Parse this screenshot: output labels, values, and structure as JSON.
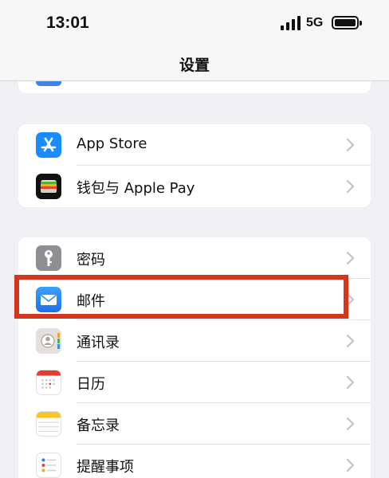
{
  "status_bar": {
    "time": "13:01",
    "network": "5G"
  },
  "nav": {
    "title": "设置"
  },
  "groups": [
    {
      "items": [
        {
          "label": "App Store",
          "icon": "app-store-icon"
        },
        {
          "label": "钱包与 Apple Pay",
          "icon": "wallet-icon"
        }
      ]
    },
    {
      "items": [
        {
          "label": "密码",
          "icon": "key-icon"
        },
        {
          "label": "邮件",
          "icon": "mail-icon",
          "highlighted": true
        },
        {
          "label": "通讯录",
          "icon": "contacts-icon"
        },
        {
          "label": "日历",
          "icon": "calendar-icon"
        },
        {
          "label": "备忘录",
          "icon": "notes-icon"
        },
        {
          "label": "提醒事项",
          "icon": "reminders-icon"
        }
      ]
    }
  ],
  "colors": {
    "highlight": "#d7341c",
    "app_store": "#1a8cff",
    "mail": "#2b8af6",
    "background": "#efeff4"
  }
}
